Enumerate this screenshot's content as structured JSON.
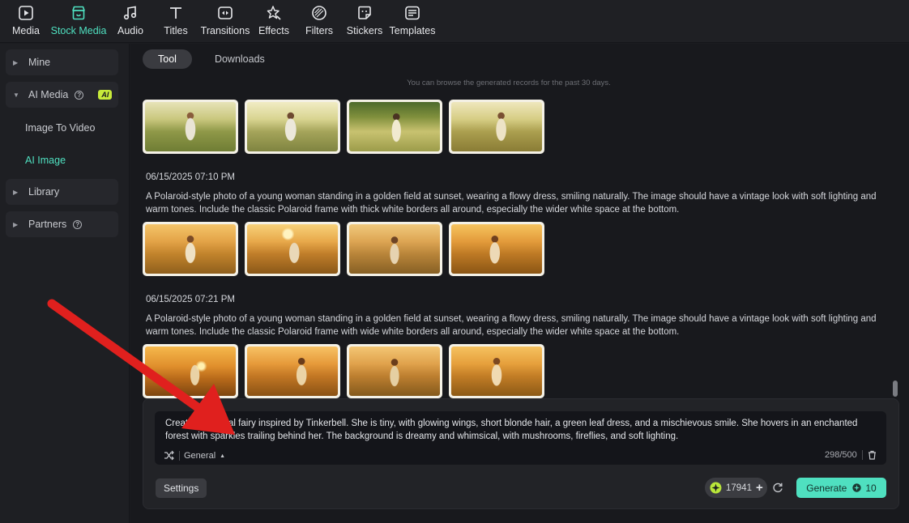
{
  "top_nav": [
    {
      "label": "Media",
      "icon": "media-icon"
    },
    {
      "label": "Stock Media",
      "icon": "stock-media-icon",
      "active": true
    },
    {
      "label": "Audio",
      "icon": "music-note-icon"
    },
    {
      "label": "Titles",
      "icon": "text-t-icon"
    },
    {
      "label": "Transitions",
      "icon": "transitions-icon"
    },
    {
      "label": "Effects",
      "icon": "effects-icon"
    },
    {
      "label": "Filters",
      "icon": "filters-icon"
    },
    {
      "label": "Stickers",
      "icon": "stickers-icon"
    },
    {
      "label": "Templates",
      "icon": "templates-icon"
    }
  ],
  "sidebar": {
    "mine": "Mine",
    "ai_media": "AI Media",
    "ai_badge": "AI",
    "image_to_video": "Image To Video",
    "ai_image": "AI Image",
    "library": "Library",
    "partners": "Partners"
  },
  "tabs": {
    "tool": "Tool",
    "downloads": "Downloads"
  },
  "history_note": "You can browse the generated records for the past 30 days.",
  "records": [
    {
      "timestamp": "06/15/2025 07:10 PM",
      "prompt": "A Polaroid-style photo of a young woman standing in a golden field at sunset, wearing a flowy dress, smiling naturally. The image should have a vintage look with soft lighting and warm tones. Include the classic Polaroid frame with thick white borders all around, especially the wider white space at the bottom."
    },
    {
      "timestamp": "06/15/2025 07:21 PM",
      "prompt": "A Polaroid-style photo of a young woman standing in a golden field at sunset, wearing a flowy dress, smiling naturally. The image should have a vintage look with soft lighting and warm tones. Include the classic Polaroid frame with wide white borders all around, especially the wider white space at the bottom."
    }
  ],
  "input": {
    "text": "Create a magical fairy inspired by Tinkerbell. She is tiny, with glowing wings, short blonde hair, a green leaf dress, and a mischievous smile. She hovers in an enchanted forest with sparkles trailing behind her. The background is dreamy and whimsical, with mushrooms, fireflies, and soft lighting.",
    "style": "General",
    "counter": "298/500"
  },
  "footer": {
    "settings_label": "Settings",
    "credits": "17941",
    "generate_label": "Generate",
    "generate_cost": "10"
  },
  "colors": {
    "accent": "#4fe0c0",
    "badge": "#c7ea3a",
    "annotation_arrow": "#e0201e"
  }
}
